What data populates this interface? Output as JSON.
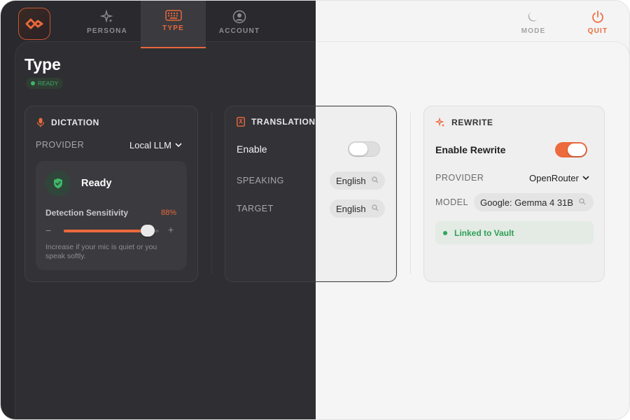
{
  "header": {
    "tabs": [
      {
        "label": "PERSONA",
        "icon": "sparkle-icon"
      },
      {
        "label": "TYPE",
        "icon": "keyboard-icon"
      },
      {
        "label": "ACCOUNT",
        "icon": "user-circle-icon"
      }
    ],
    "mode_label": "MODE",
    "quit_label": "QUIT"
  },
  "page": {
    "title": "Type",
    "status": "READY"
  },
  "dictation": {
    "title": "DICTATION",
    "provider_label": "PROVIDER",
    "provider_value": "Local LLM",
    "status_text": "Ready",
    "sensitivity_label": "Detection Sensitivity",
    "sensitivity_value": "88%",
    "sensitivity_fraction": 0.88,
    "minus": "−",
    "plus": "+",
    "hint": "Increase if your mic is quiet or you speak softly."
  },
  "translation": {
    "title": "TRANSLATION",
    "enable_label": "Enable",
    "enabled": false,
    "speaking_label": "SPEAKING",
    "speaking_value": "English",
    "target_label": "TARGET",
    "target_value": "English"
  },
  "rewrite": {
    "title": "REWRITE",
    "enable_label": "Enable Rewrite",
    "enabled": true,
    "provider_label": "PROVIDER",
    "provider_value": "OpenRouter",
    "model_label": "MODEL",
    "model_value": "Google: Gemma 4 31B",
    "vault_status": "Linked to Vault"
  },
  "colors": {
    "accent": "#ec6a3c",
    "success": "#30a55c",
    "dark_bg": "#2a292e",
    "light_bg": "#f4f4f4"
  }
}
